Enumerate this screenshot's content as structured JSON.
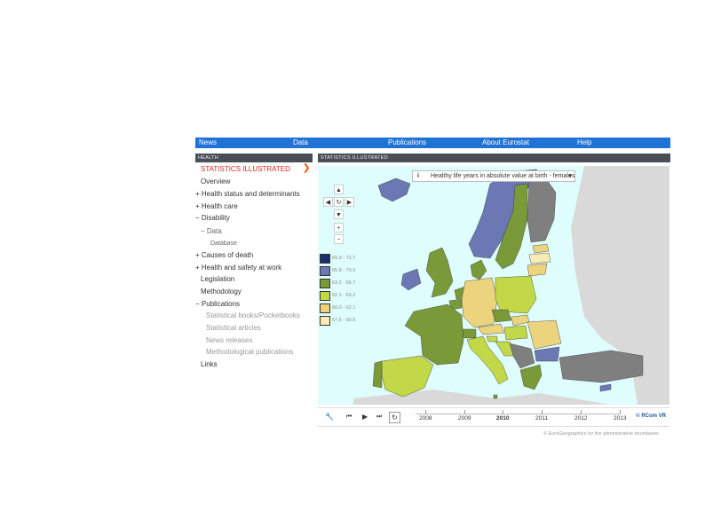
{
  "nav": [
    "News",
    "Data",
    "Publications",
    "About Eurostat",
    "Help"
  ],
  "left_header": "HEALTH",
  "right_header": "STATISTICS ILLUSTRATED",
  "menu": [
    {
      "label": "STATISTICS ILLUSTRATED",
      "prefix": ""
    },
    {
      "label": "Overview",
      "prefix": ""
    },
    {
      "label": "Health status and determinants",
      "prefix": "+"
    },
    {
      "label": "Health care",
      "prefix": "+"
    },
    {
      "label": "Disability",
      "prefix": "−"
    },
    {
      "label": "Data",
      "prefix": "−"
    },
    {
      "label": "Database",
      "prefix": ""
    },
    {
      "label": "Causes of death",
      "prefix": "+"
    },
    {
      "label": "Health and safety at work",
      "prefix": "+"
    },
    {
      "label": "Legislation",
      "prefix": ""
    },
    {
      "label": "Methodology",
      "prefix": ""
    },
    {
      "label": "Publications",
      "prefix": "−"
    },
    {
      "label": "Statistical books/Pocketbooks",
      "prefix": ""
    },
    {
      "label": "Statistical articles",
      "prefix": ""
    },
    {
      "label": "News releases",
      "prefix": ""
    },
    {
      "label": "Methodological publications",
      "prefix": ""
    },
    {
      "label": "Links",
      "prefix": ""
    }
  ],
  "active_arrow": "❯",
  "map": {
    "indicator": "Healthy life years in absolute value at birth - females",
    "info_icon": "i",
    "dropdown_icon": "▾",
    "controls": {
      "up": "▲",
      "left": "◀",
      "reset": "↻",
      "right": "▶",
      "down": "▼",
      "zoom_in": "+",
      "zoom_out": "−"
    },
    "legend": [
      {
        "label": "69.3 - 72.7",
        "color": "#1a2e6e"
      },
      {
        "label": "65.8 - 70.3",
        "color": "#6b78b4"
      },
      {
        "label": "63.2 - 65.7",
        "color": "#7a9a3a"
      },
      {
        "label": "62.1 - 63.2",
        "color": "#c3d848"
      },
      {
        "label": "60.0 - 62.1",
        "color": "#ecd47f"
      },
      {
        "label": "57.6 - 60.0",
        "color": "#f9eab6"
      }
    ],
    "no_data_color": "#7f7f7f",
    "sea_color": "#e0fdfd",
    "outside_color": "#d9d9d9"
  },
  "timeline": {
    "years": [
      "2008",
      "2009",
      "2010",
      "2011",
      "2012",
      "2013"
    ],
    "selected": "2010",
    "brand": "© RCom VR",
    "icons": {
      "settings": "🔧",
      "first": "⏮",
      "play": "▶",
      "next": "⏭",
      "loop": "↻"
    }
  },
  "copyright": "© EuroGeographics for the administrative boundaries"
}
